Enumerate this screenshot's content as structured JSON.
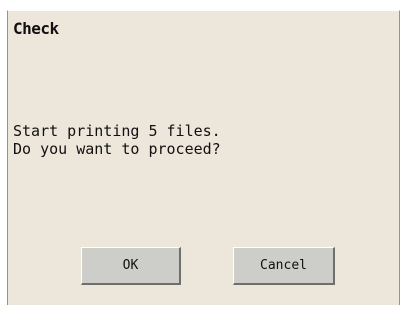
{
  "dialog": {
    "title": "Check",
    "message_lines": [
      "Start printing 5 files.",
      "Do you want to proceed?"
    ],
    "buttons": {
      "ok_label": "OK",
      "cancel_label": "Cancel"
    }
  },
  "colors": {
    "dialog_background": "#ede6db",
    "button_face": "#cdcdc9",
    "frame_border": "#7a9ab3"
  }
}
